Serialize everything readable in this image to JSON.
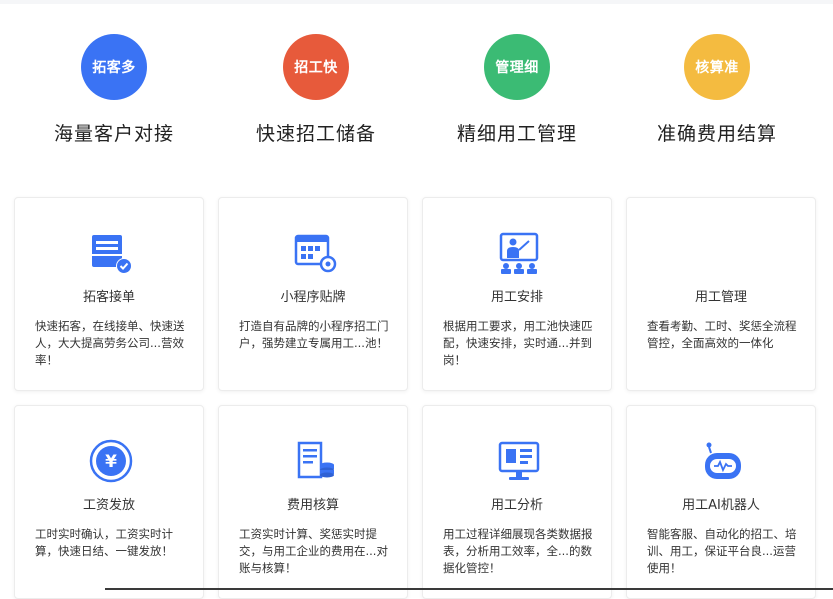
{
  "colors": {
    "blue": "#3a73f4",
    "red": "#e75a3b",
    "green": "#3bbb74",
    "yellow": "#f4bb40",
    "icon_blue": "#3a73f4"
  },
  "features": [
    {
      "badge": "拓客多",
      "title": "海量客户对接",
      "color": "#3a73f4"
    },
    {
      "badge": "招工快",
      "title": "快速招工储备",
      "color": "#e75a3b"
    },
    {
      "badge": "管理细",
      "title": "精细用工管理",
      "color": "#3bbb74"
    },
    {
      "badge": "核算准",
      "title": "准确费用结算",
      "color": "#f4bb40"
    }
  ],
  "cards": [
    {
      "icon": "order-card-icon",
      "title": "拓客接单",
      "desc": "快速拓客，在线接单、快速送人，大大提高劳务公司...营效率！"
    },
    {
      "icon": "mini-program-icon",
      "title": "小程序贴牌",
      "desc": "打造自有品牌的小程序招工门户，强势建立专属用工...池！"
    },
    {
      "icon": "presentation-icon",
      "title": "用工安排",
      "desc": "根据用工要求，用工池快速匹配，快速安排，实时通...并到岗！"
    },
    {
      "icon": "",
      "title": "用工管理",
      "desc": "查看考勤、工时、奖惩全流程管控，全面高效的一体化"
    },
    {
      "icon": "yuan-coin-icon",
      "title": "工资发放",
      "desc": "工时实时确认，工资实时计算，快速日结、一键发放！"
    },
    {
      "icon": "expense-doc-icon",
      "title": "费用核算",
      "desc": "工资实时计算、奖惩实时提交，与用工企业的费用在...对账与核算！"
    },
    {
      "icon": "monitor-chart-icon",
      "title": "用工分析",
      "desc": "用工过程详细展现各类数据报表，分析用工效率，全...的数据化管控！"
    },
    {
      "icon": "robot-icon",
      "title": "用工AI机器人",
      "desc": "智能客服、自动化的招工、培训、用工，保证平台良...运营使用！"
    }
  ]
}
